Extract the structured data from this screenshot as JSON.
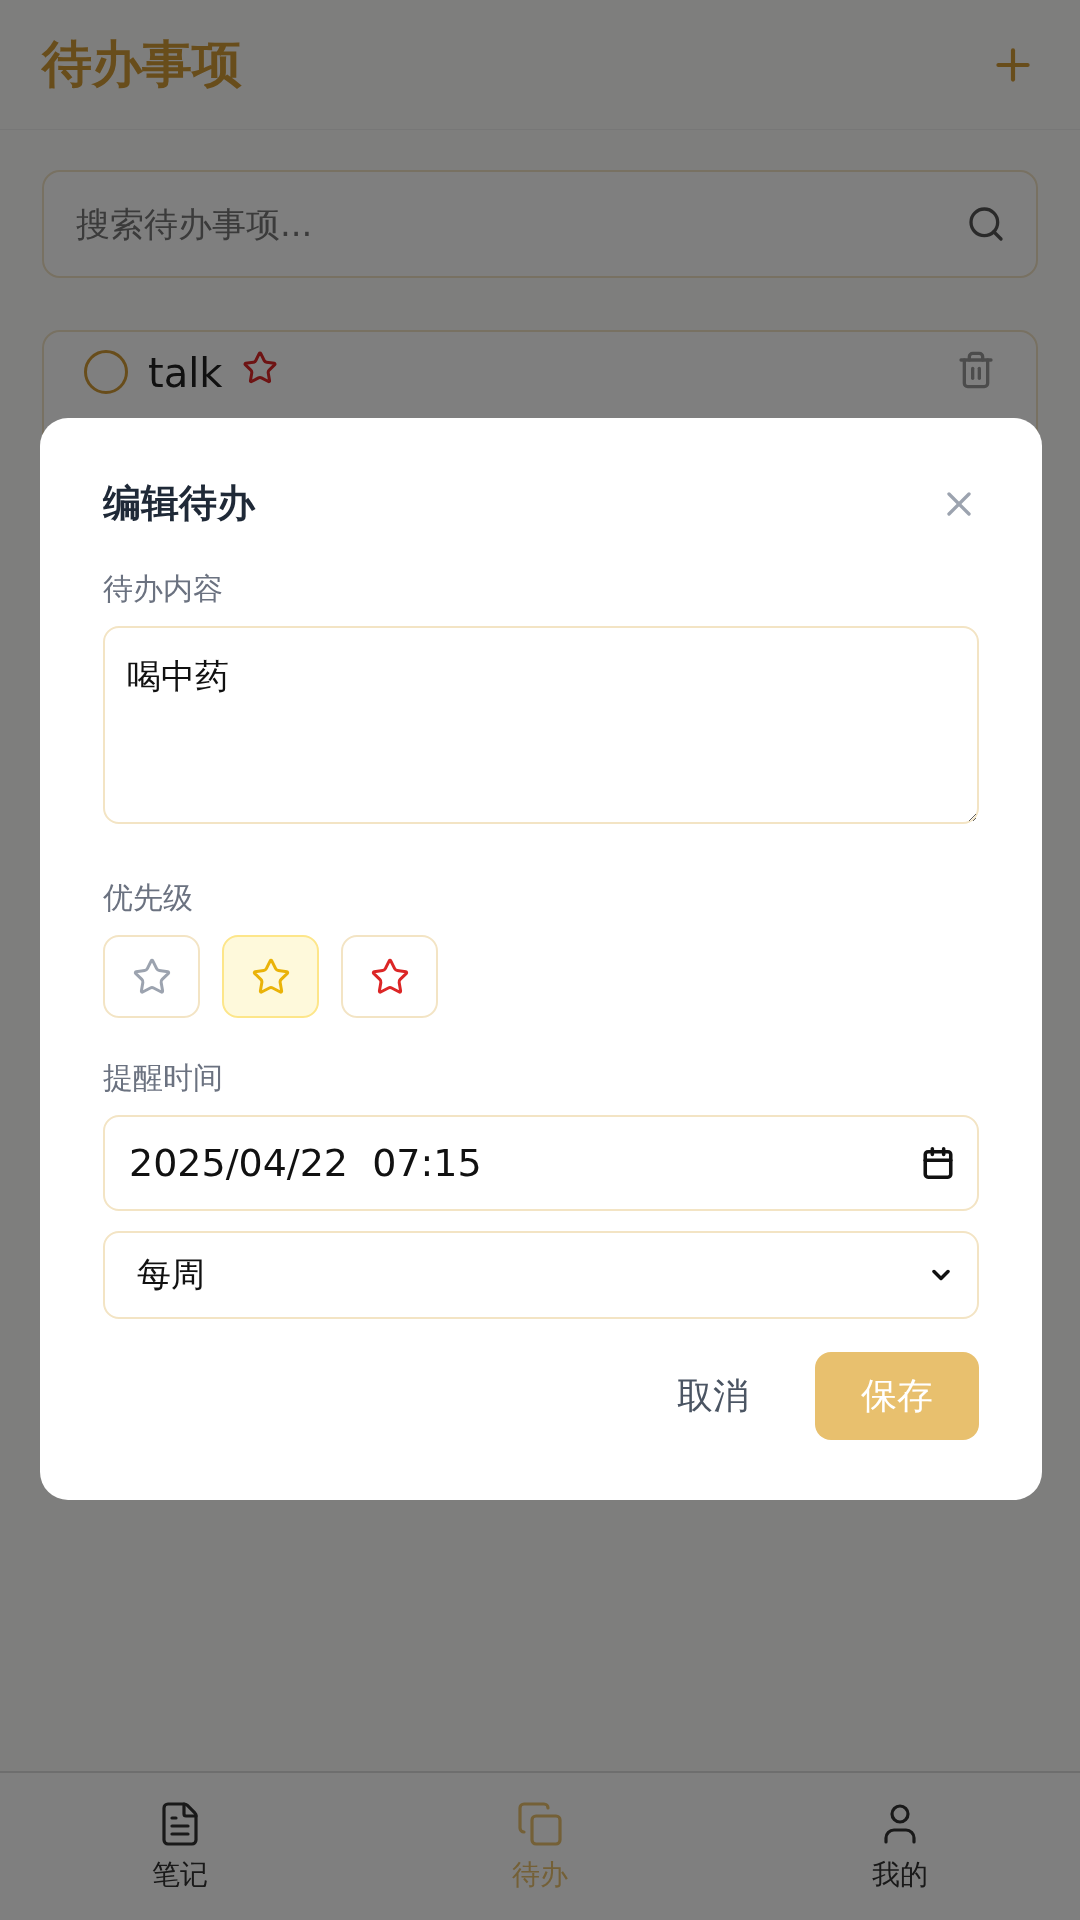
{
  "header": {
    "title": "待办事项"
  },
  "search": {
    "placeholder": "搜索待办事项..."
  },
  "todos": [
    {
      "text": "talk",
      "done": false
    }
  ],
  "dialog": {
    "title": "编辑待办",
    "content_label": "待办内容",
    "content_value": "喝中药",
    "priority_label": "优先级",
    "priorities": [
      {
        "selected": false,
        "color": "#9ca3af"
      },
      {
        "selected": true,
        "color": "#eab308"
      },
      {
        "selected": false,
        "color": "#dc2626"
      }
    ],
    "reminder_label": "提醒时间",
    "datetime_value": "2025/04/22  07:15",
    "repeat_value": "每周",
    "cancel": "取消",
    "save": "保存"
  },
  "nav": [
    {
      "label": "笔记",
      "kind": "note",
      "selected": false
    },
    {
      "label": "待办",
      "kind": "todo",
      "selected": true
    },
    {
      "label": "我的",
      "kind": "user",
      "selected": false
    }
  ]
}
